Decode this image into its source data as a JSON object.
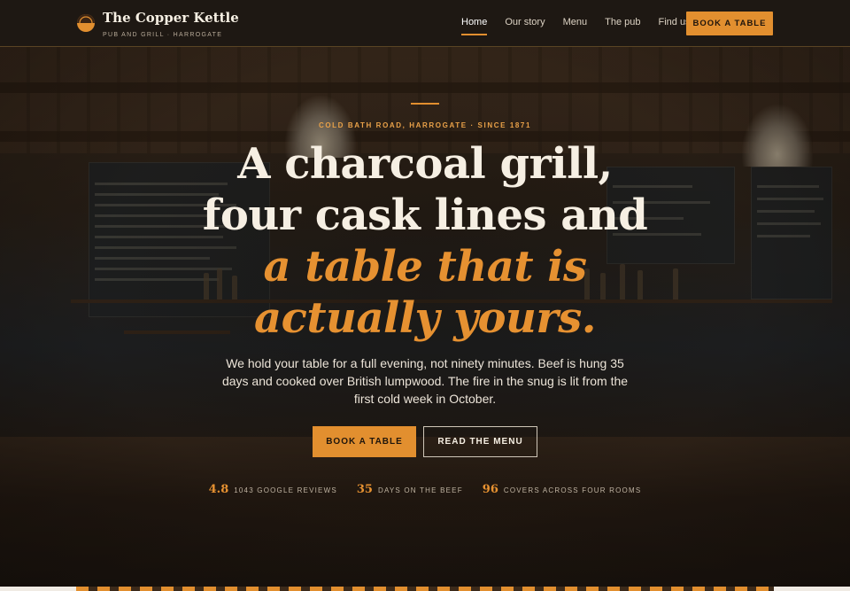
{
  "header": {
    "brand_name": "The Copper Kettle",
    "brand_tagline": "PUB AND GRILL · HARROGATE",
    "logo_icon": "copper-kettle-logo",
    "nav": [
      {
        "label": "Home",
        "active": true
      },
      {
        "label": "Our story",
        "active": false
      },
      {
        "label": "Menu",
        "active": false
      },
      {
        "label": "The pub",
        "active": false
      },
      {
        "label": "Find us",
        "active": false
      }
    ],
    "cta_label": "BOOK A TABLE"
  },
  "hero": {
    "eyebrow": "COLD BATH ROAD, HARROGATE · SINCE 1871",
    "headline_line1": "A charcoal grill,",
    "headline_line2": "four cask lines and",
    "headline_accent_line1": "a table that is",
    "headline_accent_line2": "actually yours.",
    "lede": "We hold your table for a full evening, not ninety minutes. Beef is hung 35 days and cooked over British lumpwood. The fire in the snug is lit from the first cold week in October.",
    "primary_button": "BOOK A TABLE",
    "secondary_button": "READ THE MENU",
    "stats": [
      {
        "value": "4.8",
        "label": "1043 GOOGLE REVIEWS"
      },
      {
        "value": "35",
        "label": "DAYS ON THE BEEF"
      },
      {
        "value": "96",
        "label": "COVERS ACROSS FOUR ROOMS"
      }
    ]
  },
  "colors": {
    "accent": "#e28f2f",
    "header_bg": "#1e1813",
    "text_light": "#f6efe3"
  }
}
